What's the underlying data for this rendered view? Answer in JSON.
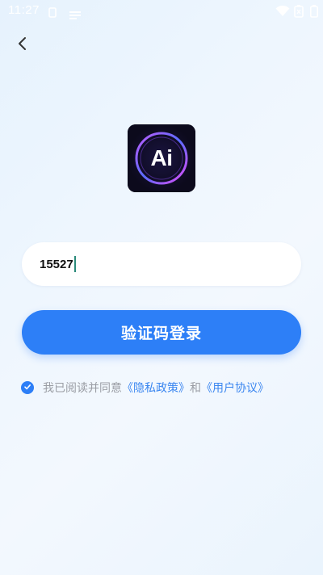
{
  "status_bar": {
    "time": "11:27",
    "icons": [
      "notification-icon",
      "wifi-icon",
      "battery-x-icon"
    ]
  },
  "nav": {
    "back_icon": "chevron-left-icon"
  },
  "logo": {
    "text": "Ai"
  },
  "form": {
    "phone_value": "15527"
  },
  "login_button": {
    "label": "验证码登录"
  },
  "agreement": {
    "checked": true,
    "prefix": "我已阅读并同意",
    "privacy_link": "《隐私政策》",
    "conjunction": "和",
    "terms_link": "《用户协议》"
  },
  "colors": {
    "accent": "#2d7ff7",
    "link": "#3a86f0",
    "muted_text": "#9a9da4"
  }
}
